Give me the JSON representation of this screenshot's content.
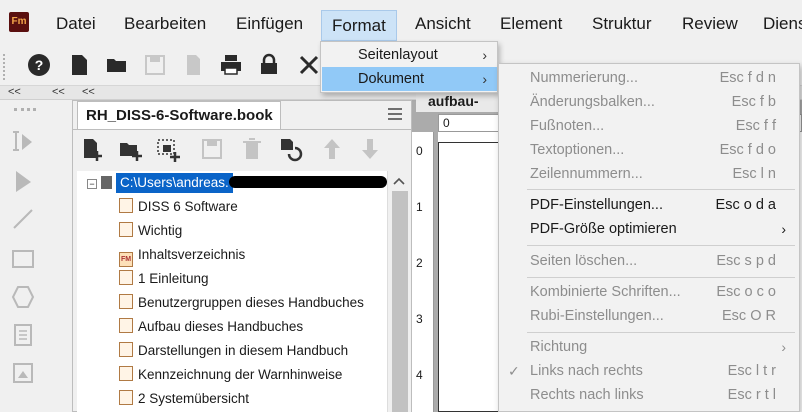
{
  "app": {
    "logo_text": "Fm"
  },
  "menubar": {
    "items": [
      "Datei",
      "Bearbeiten",
      "Einfügen",
      "Format",
      "Ansicht",
      "Element",
      "Struktur",
      "Review",
      "Diens"
    ]
  },
  "format_menu": {
    "items": [
      {
        "label": "Seitenlayout",
        "has_submenu": true
      },
      {
        "label": "Dokument",
        "has_submenu": true,
        "highlighted": true
      }
    ]
  },
  "document_menu": {
    "items": [
      {
        "label": "Nummerierung...",
        "shortcut": "Esc f d n",
        "enabled": false
      },
      {
        "label": "Änderungsbalken...",
        "shortcut": "Esc f b",
        "enabled": false
      },
      {
        "label": "Fußnoten...",
        "shortcut": "Esc f f",
        "enabled": false
      },
      {
        "label": "Textoptionen...",
        "shortcut": "Esc f d o",
        "enabled": false
      },
      {
        "label": "Zeilennummern...",
        "shortcut": "Esc l n",
        "enabled": false
      },
      {
        "label": "PDF-Einstellungen...",
        "shortcut": "Esc o d a",
        "enabled": true
      },
      {
        "label": "PDF-Größe optimieren",
        "shortcut": "",
        "enabled": true,
        "has_submenu": true
      },
      {
        "label": "Seiten löschen...",
        "shortcut": "Esc s p d",
        "enabled": false
      },
      {
        "label": "Kombinierte Schriften...",
        "shortcut": "Esc o c o",
        "enabled": false
      },
      {
        "label": "Rubi-Einstellungen...",
        "shortcut": "Esc O R",
        "enabled": false
      },
      {
        "label": "Richtung",
        "shortcut": "",
        "enabled": false,
        "has_submenu": true
      },
      {
        "label": "Links nach rechts",
        "shortcut": "Esc l t r",
        "enabled": false,
        "checked": true
      },
      {
        "label": "Rechts nach links",
        "shortcut": "Esc r t l",
        "enabled": false
      }
    ]
  },
  "book_panel": {
    "tab_title": "RH_DISS-6-Software.book",
    "root_path": "C:\\Users\\andreas.",
    "items": [
      "DISS 6 Software",
      "Wichtig",
      "Inhaltsverzeichnis",
      "1 Einleitung",
      "Benutzergruppen dieses Handbuches",
      "Aufbau dieses Handbuches",
      "Darstellungen in diesem Handbuch",
      "Kennzeichnung der Warnhinweise",
      "2 Systemübersicht"
    ]
  },
  "document_area": {
    "tab_title": "aufbau-",
    "ruler_top_start": "0",
    "ruler_left_numbers": [
      "0",
      "1",
      "2",
      "3",
      "4"
    ]
  },
  "collapse_markers": {
    "left": "<<"
  }
}
